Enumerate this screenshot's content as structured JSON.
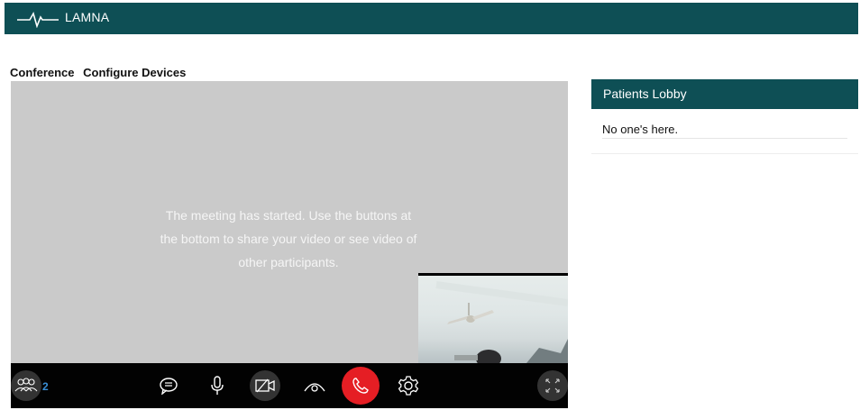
{
  "app": {
    "title": "LAMNA"
  },
  "tabs": [
    {
      "label": "Conference"
    },
    {
      "label": "Configure Devices"
    }
  ],
  "stage": {
    "message": "The meeting has started. Use the buttons at the bottom to share your video or see video of other participants."
  },
  "controls": {
    "participants_count": "2",
    "icons": [
      "participants-icon",
      "chat-icon",
      "microphone-icon",
      "camera-off-icon",
      "share-screen-icon",
      "end-call-icon",
      "settings-icon",
      "fullscreen-icon"
    ]
  },
  "lobby": {
    "title": "Patients Lobby",
    "empty_text": "No one's here."
  },
  "colors": {
    "brand": "#0e4f55",
    "stage_bg": "#cacaca",
    "control_bar": "#020202",
    "end_call": "#e51e24",
    "count_accent": "#3a8fd6"
  }
}
